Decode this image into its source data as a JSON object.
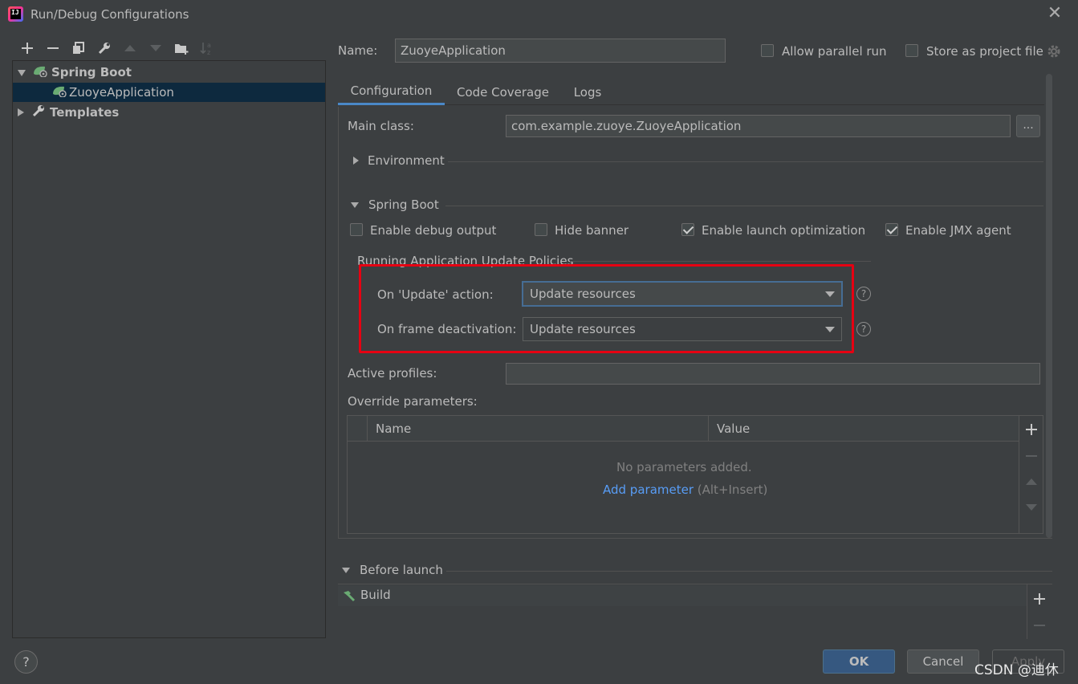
{
  "window": {
    "title": "Run/Debug Configurations"
  },
  "tree": {
    "items": [
      {
        "label": "Spring Boot",
        "expanded": true
      },
      {
        "label": "ZuoyeApplication",
        "selected": true
      },
      {
        "label": "Templates",
        "expanded": false
      }
    ]
  },
  "header": {
    "name_label": "Name:",
    "name_value": "ZuoyeApplication",
    "allow_parallel": "Allow parallel run",
    "store_project": "Store as project file"
  },
  "tabs": [
    {
      "label": "Configuration",
      "active": true
    },
    {
      "label": "Code Coverage"
    },
    {
      "label": "Logs"
    }
  ],
  "config": {
    "main_class_label": "Main class:",
    "main_class_value": "com.example.zuoye.ZuoyeApplication",
    "browse": "...",
    "environment": "Environment",
    "spring_boot": "Spring Boot",
    "checks": [
      {
        "label": "Enable debug output",
        "checked": false
      },
      {
        "label": "Hide banner",
        "checked": false
      },
      {
        "label": "Enable launch optimization",
        "checked": true
      },
      {
        "label": "Enable JMX agent",
        "checked": true
      }
    ],
    "policies_title": "Running Application Update Policies",
    "update_action_label": "On 'Update' action:",
    "update_action_value": "Update resources",
    "frame_deactivation_label": "On frame deactivation:",
    "frame_deactivation_value": "Update resources",
    "help_glyph": "?",
    "active_profiles_label": "Active profiles:",
    "active_profiles_value": "",
    "override_label": "Override parameters:",
    "table": {
      "columns": [
        "Name",
        "Value"
      ],
      "empty": "No parameters added.",
      "add_link": "Add parameter",
      "add_shortcut": "(Alt+Insert)"
    }
  },
  "before_launch": {
    "title": "Before launch",
    "items": [
      "Build"
    ]
  },
  "footer": {
    "ok": "OK",
    "cancel": "Cancel",
    "apply": "Apply",
    "help": "?"
  },
  "watermark": "CSDN @迪休",
  "colors": {
    "highlight_box": "#e60012",
    "accent": "#4a88c7",
    "link": "#589df6"
  }
}
